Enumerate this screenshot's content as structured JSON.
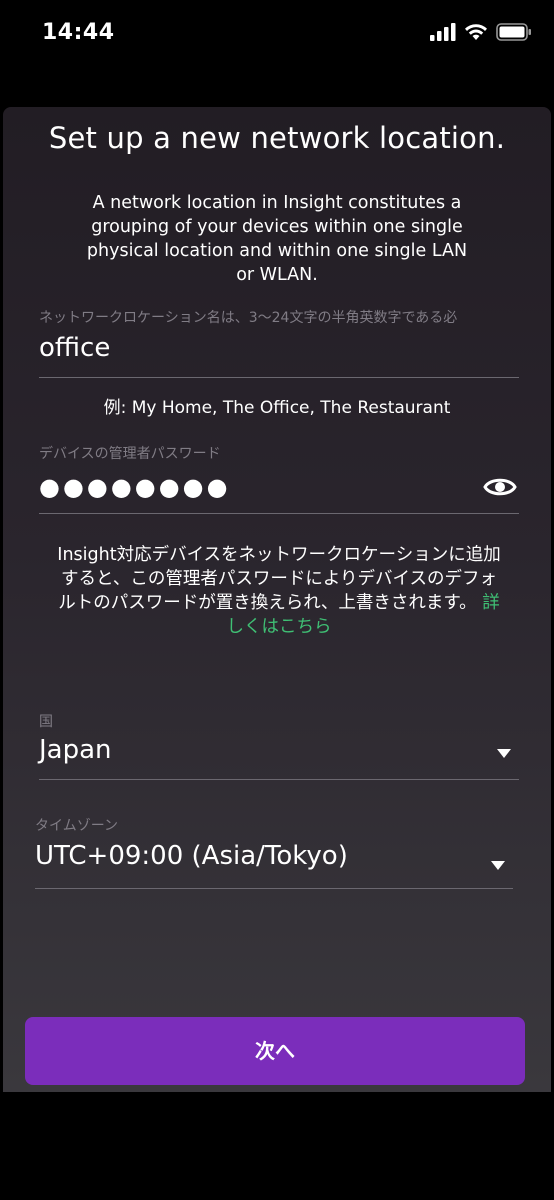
{
  "status_bar": {
    "time": "14:44",
    "icons": [
      "cellular-signal-icon",
      "wifi-icon",
      "battery-icon"
    ]
  },
  "page": {
    "title": "Set up a new network location.",
    "description": "A network location in Insight constitutes a grouping of your devices within one single physical location and within one single LAN or WLAN."
  },
  "location_name": {
    "label": "ネットワークロケーション名は、3〜24文字の半角英数字である必",
    "value": "office",
    "example": "例: My Home, The Office, The Restaurant"
  },
  "admin_password": {
    "label": "デバイスの管理者パスワード",
    "value_masked": "●●●●●●●●",
    "toggle_icon": "eye-icon"
  },
  "info": {
    "text": "Insight対応デバイスをネットワークロケーションに追加すると、この管理者パスワードによりデバイスのデフォルトのパスワードが置き換えられ、上書きされます。",
    "link_label": "詳しくはこちら"
  },
  "country": {
    "label": "国",
    "value": "Japan"
  },
  "timezone": {
    "label": "タイムゾーン",
    "value": "UTC+09:00 (Asia/Tokyo)"
  },
  "actions": {
    "next_label": "次へ"
  },
  "colors": {
    "accent": "#7b2dbb",
    "link": "#3fbf74",
    "label": "#807c85"
  }
}
